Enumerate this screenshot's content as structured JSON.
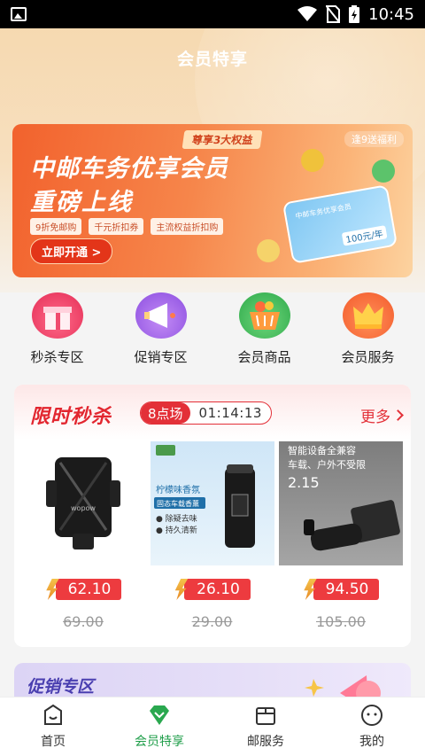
{
  "status_bar": {
    "time": "10:45"
  },
  "header": {
    "title": "会员特享"
  },
  "banner": {
    "headline1": "中邮车务优享会员",
    "headline2": "重磅上线",
    "tag": "尊享3大权益",
    "corner": "逢9送福利",
    "chips": [
      "9折免邮购",
      "千元折扣券",
      "主流权益折扣购"
    ],
    "cta": "立即开通 >",
    "card_title": "中邮车务优享会员",
    "card_value": "100元/年"
  },
  "categories": [
    {
      "label": "秒杀专区",
      "icon": "gift-icon"
    },
    {
      "label": "促销专区",
      "icon": "megaphone-icon"
    },
    {
      "label": "会员商品",
      "icon": "basket-icon"
    },
    {
      "label": "会员服务",
      "icon": "crown-icon"
    }
  ],
  "flash_sale": {
    "title": "限时秒杀",
    "session": "8点场",
    "countdown": "01:14:13",
    "more": "更多",
    "products": [
      {
        "name": "wopow car phone holder",
        "brand": "wopow",
        "price": "62.10",
        "old_price": "69.00"
      },
      {
        "name": "柠檬味香氛",
        "caption1": "柠檬味香氛",
        "caption2": "固态车载香薰",
        "caption3": "● 除疑去味",
        "caption4": "● 持久清新",
        "price": "26.10",
        "old_price": "29.00"
      },
      {
        "name": "智能设备全兼容",
        "caption1": "智能设备全兼容",
        "caption2": "车载、户外不受限",
        "caption3": "2.15",
        "price": "94.50",
        "old_price": "105.00"
      }
    ]
  },
  "promo": {
    "title": "促销专区"
  },
  "tabbar": [
    {
      "label": "首页",
      "icon": "home-icon",
      "active": false
    },
    {
      "label": "会员特享",
      "icon": "diamond-icon",
      "active": true
    },
    {
      "label": "邮服务",
      "icon": "box-icon",
      "active": false
    },
    {
      "label": "我的",
      "icon": "profile-icon",
      "active": false
    }
  ]
}
